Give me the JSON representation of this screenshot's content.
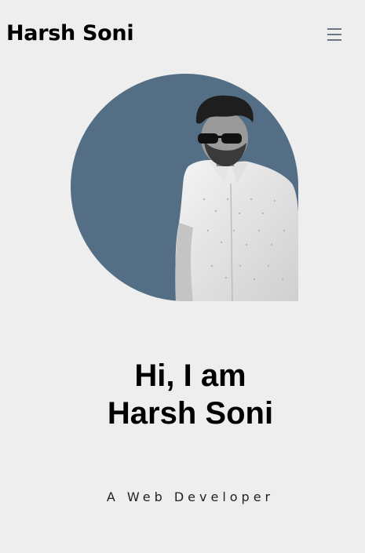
{
  "header": {
    "brand": "Harsh Soni",
    "menu_icon": "hamburger-menu-icon"
  },
  "hero": {
    "greeting_line1": "Hi, I am",
    "greeting_line2": "Harsh Soni",
    "subtitle": "A Web Developer",
    "photo_bg_color": "#546e85"
  }
}
